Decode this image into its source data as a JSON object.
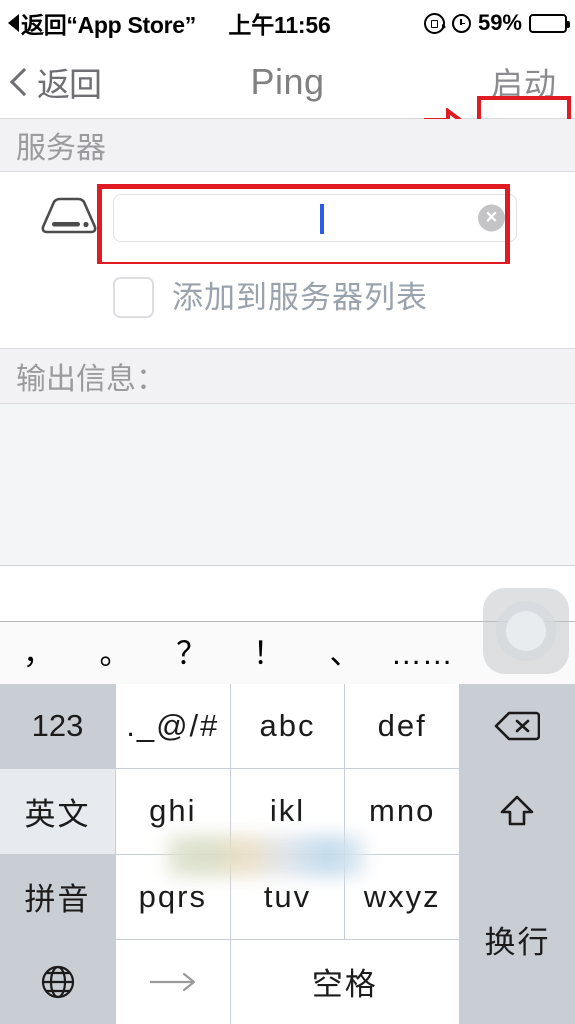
{
  "status_bar": {
    "back_label": "返回“App Store”",
    "time": "上午11:56",
    "rotation_lock_icon": "rotation-lock-icon",
    "alarm_icon": "alarm-icon",
    "battery_percent": "59%",
    "battery_level": 59
  },
  "nav_bar": {
    "back_label": "返回",
    "title": "Ping",
    "action_label": "启动",
    "annotation_color": "#e01b24"
  },
  "sections": {
    "server_header": "服务器",
    "output_header": "输出信息："
  },
  "server_field": {
    "icon": "server-disk-icon",
    "value": "",
    "placeholder": "",
    "clear_icon": "×",
    "caret_color": "#2b5ce6"
  },
  "add_to_list": {
    "checked": false,
    "label": "添加到服务器列表"
  },
  "output": {
    "text": ""
  },
  "assistive_touch": {
    "icon": "assistive-touch-icon"
  },
  "keyboard": {
    "punctuation": [
      "，",
      "。",
      "？",
      "！",
      "、",
      "……"
    ],
    "rows": [
      [
        {
          "label": "123",
          "type": "fn"
        },
        {
          "label": "._@/#",
          "type": "letter"
        },
        {
          "label": "abc",
          "type": "letter"
        },
        {
          "label": "def",
          "type": "letter"
        },
        {
          "label": "",
          "type": "fn",
          "icon": "backspace-icon"
        }
      ],
      [
        {
          "label": "英文",
          "type": "fn-light"
        },
        {
          "label": "ghi",
          "type": "letter"
        },
        {
          "label": "ikl",
          "type": "letter"
        },
        {
          "label": "mno",
          "type": "letter"
        },
        {
          "label": "",
          "type": "fn",
          "icon": "shift-icon"
        }
      ],
      [
        {
          "label": "拼音",
          "type": "fn"
        },
        {
          "label": "pqrs",
          "type": "letter"
        },
        {
          "label": "tuv",
          "type": "letter"
        },
        {
          "label": "wxyz",
          "type": "letter"
        },
        {
          "label": "换行",
          "type": "fn"
        }
      ],
      [
        {
          "label": "",
          "type": "fn",
          "icon": "globe-icon"
        },
        {
          "label": "",
          "type": "letter",
          "icon": "next-arrow-icon"
        },
        {
          "label": "空格",
          "type": "letter"
        }
      ]
    ],
    "key_gray": "#c9ced5",
    "key_white": "#ffffff"
  }
}
